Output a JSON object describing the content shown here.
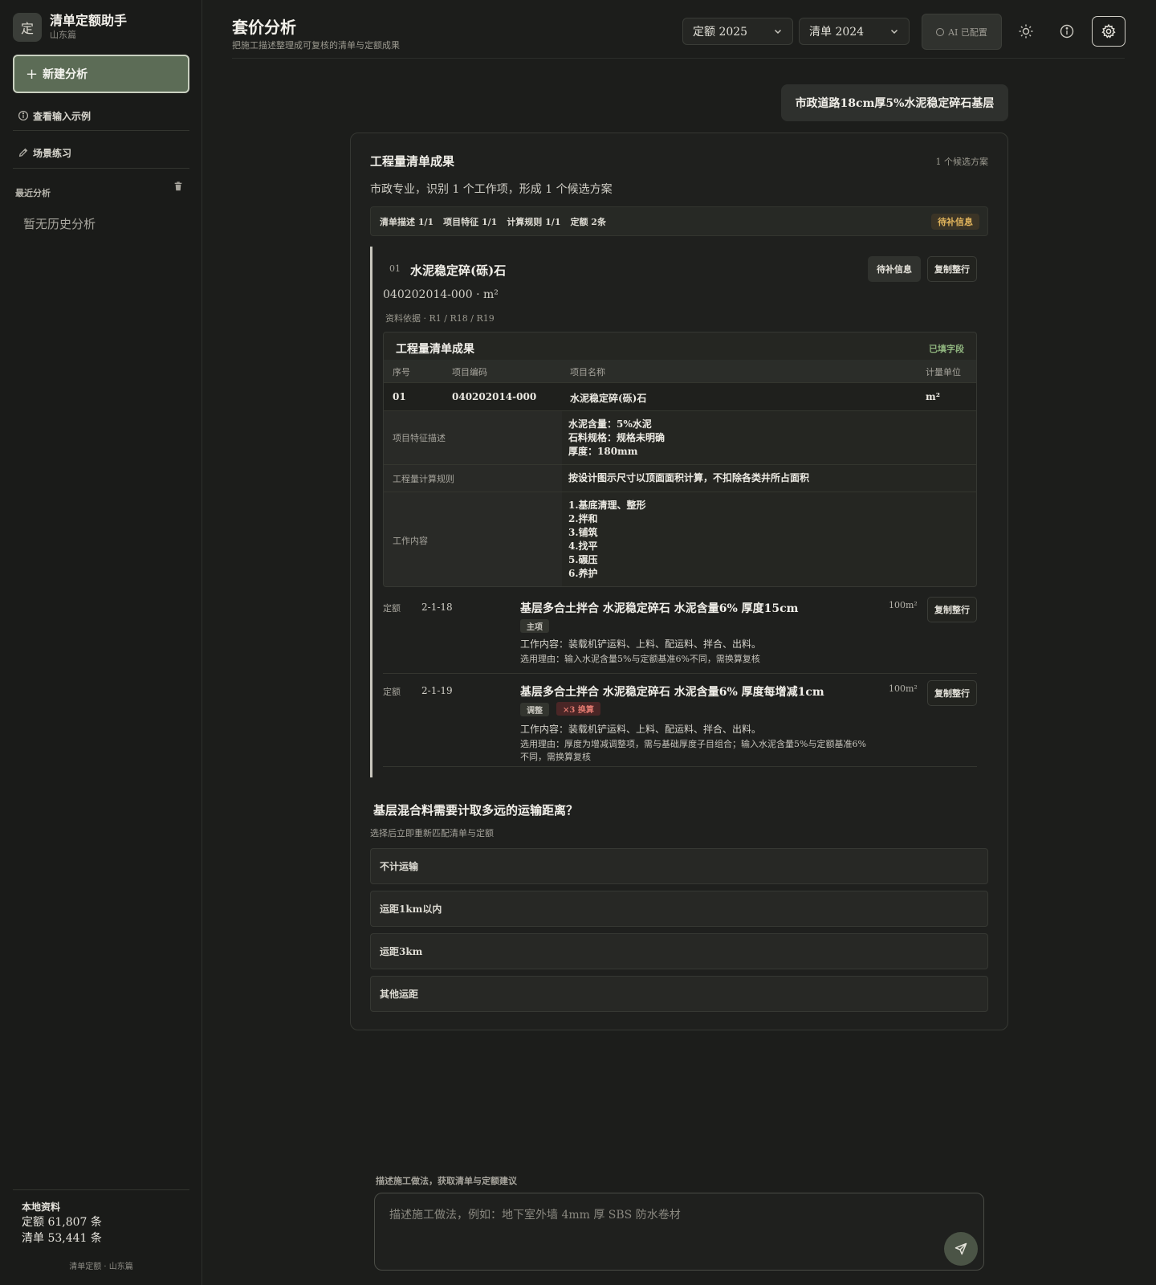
{
  "sidebar": {
    "brand": {
      "logo_char": "定",
      "title": "清单定额助手",
      "subtitle": "山东篇"
    },
    "new_analysis": "新建分析",
    "view_examples": "查看输入示例",
    "practice": "场景练习",
    "recent_label": "最近分析",
    "no_history": "暂无历史分析",
    "local": {
      "title": "本地资料",
      "quota_line": "定额 61,807 条",
      "list_line": "清单 53,441 条"
    },
    "footer": "清单定额 · 山东篇"
  },
  "header": {
    "title": "套价分析",
    "subtitle": "把施工描述整理成可复核的清单与定额成果",
    "quota_select": "定额 2025",
    "list_select": "清单 2024",
    "ai_status": "AI 已配置",
    "icons": [
      "sun-icon",
      "info-icon",
      "gear-icon"
    ]
  },
  "query": "市政道路18cm厚5%水泥稳定碎石基层",
  "result": {
    "title": "工程量清单成果",
    "candidate_count": "1 个候选方案",
    "summary": "市政专业，识别 1 个工作项，形成 1 个候选方案",
    "stats": [
      "清单描述 1/1",
      "项目特征 1/1",
      "计算规则 1/1",
      "定额 2条"
    ],
    "status_badge": "待补信息",
    "item": {
      "num": "01",
      "name": "水泥稳定碎(砾)石",
      "code_unit": "040202014-000 · m²",
      "refs": "资料依据 · R1 / R18 / R19",
      "pending_button": "待补信息",
      "copy_button": "复制整行",
      "table": {
        "title": "工程量清单成果",
        "filled_label": "已填字段",
        "headers": [
          "序号",
          "项目编码",
          "项目名称",
          "计量单位"
        ],
        "row": {
          "seq": "01",
          "code": "040202014-000",
          "name": "水泥稳定碎(砾)石",
          "unit": "m²"
        },
        "features_label": "项目特征描述",
        "features": [
          "水泥含量：5%水泥",
          "石料规格：规格未明确",
          "厚度：180mm"
        ],
        "rule_label": "工程量计算规则",
        "rule": "按设计图示尺寸以顶面面积计算，不扣除各类井所占面积",
        "work_label": "工作内容",
        "work": [
          "1.基底清理、整形",
          "2.拌和",
          "3.铺筑",
          "4.找平",
          "5.碾压",
          "6.养护"
        ]
      },
      "quotas": [
        {
          "tag": "定额",
          "code": "2-1-18",
          "name": "基层多合土拌合 水泥稳定碎石 水泥含量6% 厚度15cm",
          "unit": "100m²",
          "chips": [
            "主项"
          ],
          "work": "工作内容：装载机铲运料、上料、配运料、拌合、出料。",
          "reason": "选用理由：输入水泥含量5%与定额基准6%不同，需换算复核",
          "copy": "复制整行"
        },
        {
          "tag": "定额",
          "code": "2-1-19",
          "name": "基层多合土拌合 水泥稳定碎石 水泥含量6% 厚度每增减1cm",
          "unit": "100m²",
          "chips": [
            "调整",
            "×3 换算"
          ],
          "work": "工作内容：装载机铲运料、上料、配运料、拌合、出料。",
          "reason": "选用理由：厚度为增减调整项，需与基础厚度子目组合；输入水泥含量5%与定额基准6%不同，需换算复核",
          "copy": "复制整行"
        }
      ]
    },
    "question": {
      "title": "基层混合料需要计取多远的运输距离？",
      "subtitle": "选择后立即重新匹配清单与定额",
      "options": [
        "不计运输",
        "运距1km以内",
        "运距3km",
        "其他运距"
      ]
    }
  },
  "composer": {
    "label": "描述施工做法，获取清单与定额建议",
    "placeholder": "描述施工做法，例如：地下室外墙 4mm 厚 SBS 防水卷材"
  },
  "colors": {
    "accent_green": "#5c6c56",
    "pending_amber": "#e0b35b",
    "filled_green": "#8fb47e",
    "conversion_red": "#e0796f"
  }
}
